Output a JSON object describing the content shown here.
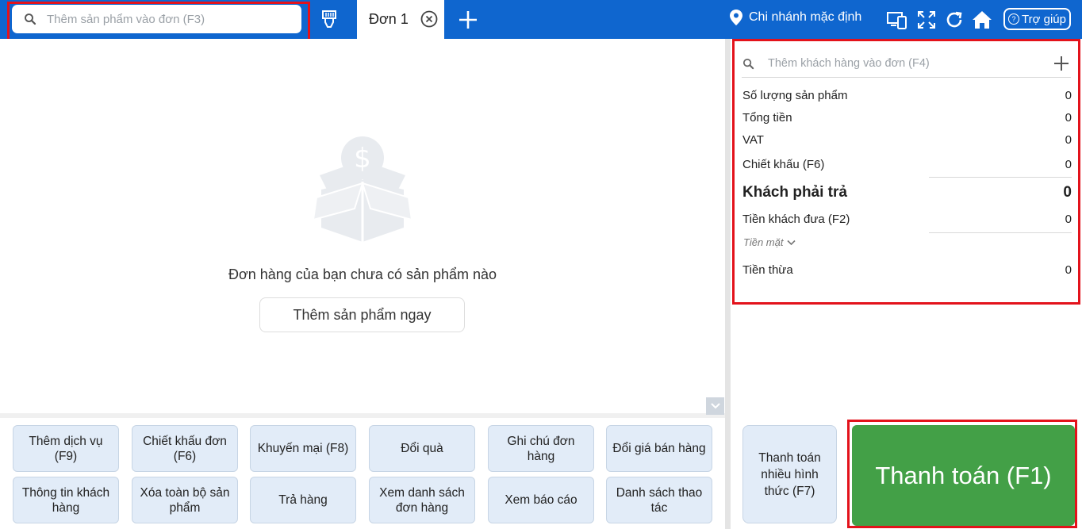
{
  "top_bar": {
    "product_search_placeholder": "Thêm sản phẩm vào đơn (F3)",
    "tab_label": "Đơn 1",
    "branch_label": "Chi nhánh mặc định",
    "help_label": "Trợ giúp"
  },
  "order_area": {
    "empty_message": "Đơn hàng của bạn chưa có sản phẩm nào",
    "add_product_now": "Thêm sản phẩm ngay"
  },
  "actions": [
    [
      "Thêm dịch vụ (F9)",
      "Chiết khấu đơn (F6)",
      "Khuyến mại (F8)",
      "Đổi quà",
      "Ghi chú đơn hàng",
      "Đổi giá bán hàng"
    ],
    [
      "Thông tin khách hàng",
      "Xóa toàn bộ sản phẩm",
      "Trả hàng",
      "Xem danh sách đơn hàng",
      "Xem báo cáo",
      "Danh sách thao tác"
    ]
  ],
  "summary": {
    "customer_search_placeholder": "Thêm khách hàng vào đơn (F4)",
    "rows": {
      "quantity": {
        "label": "Số lượng sản phẩm",
        "value": "0"
      },
      "total": {
        "label": "Tổng tiền",
        "value": "0"
      },
      "vat": {
        "label": "VAT",
        "value": "0"
      },
      "discount": {
        "label": "Chiết khấu (F6)",
        "value": "0"
      },
      "customer_pays": {
        "label": "Khách phải trả",
        "value": "0"
      },
      "customer_given": {
        "label": "Tiền khách đưa (F2)",
        "value": "0"
      },
      "change": {
        "label": "Tiền thừa",
        "value": "0"
      }
    },
    "payment_method": "Tiền mặt"
  },
  "checkout": {
    "multi_payment": "Thanh toán nhiều hình thức (F7)",
    "pay_button": "Thanh toán (F1)"
  },
  "colors": {
    "top_bar": "#0f66cf",
    "checkout_green": "#43a047",
    "highlight_red": "#e3121b",
    "action_button_bg": "#e2ecf8"
  }
}
